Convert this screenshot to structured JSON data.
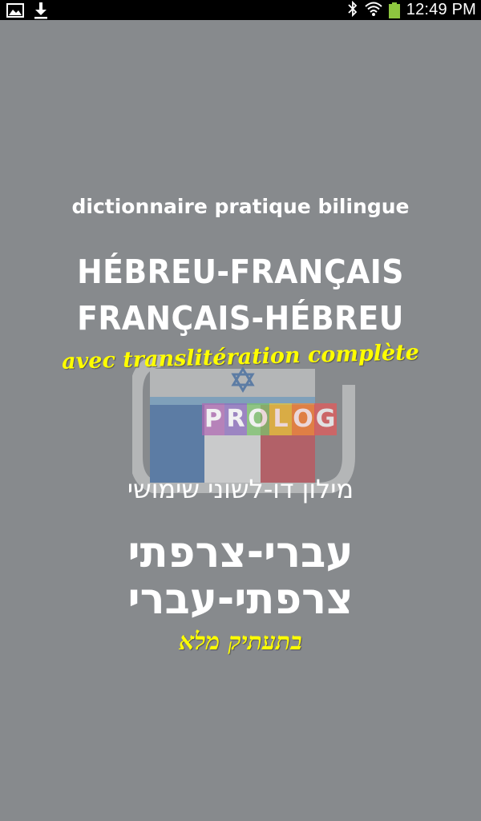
{
  "status_bar": {
    "time": "12:49 PM",
    "left_icons": [
      "image-icon",
      "download-icon"
    ],
    "right_icons": [
      "bluetooth-icon",
      "wifi-icon",
      "battery-icon"
    ],
    "battery_color": "#8dc63f"
  },
  "splash": {
    "background": "#878a8d",
    "subtitle_fr": "dictionnaire pratique bilingue",
    "title_fr_line1": "HÉBREU-FRANÇAIS",
    "title_fr_line2": "FRANÇAIS-HÉBREU",
    "translit_fr": "avec translitération complète",
    "subtitle_he": "מילון דו-לשוני שימושי",
    "title_he_line1": "עברי-צרפתי",
    "title_he_line2": "צרפתי-עברי",
    "translit_he": "בתעתיק מלא",
    "accent_color": "#ffff00",
    "logo": {
      "brand": [
        "P",
        "R",
        "O",
        "L",
        "O",
        "G"
      ],
      "brand_colors": [
        "#b06ab3",
        "#8e6fbf",
        "#7cc36b",
        "#e7c53a",
        "#ef8a3a",
        "#e25b5b"
      ],
      "flag_colors": [
        "#3a72b8",
        "#ffffff",
        "#d6404a"
      ]
    }
  }
}
